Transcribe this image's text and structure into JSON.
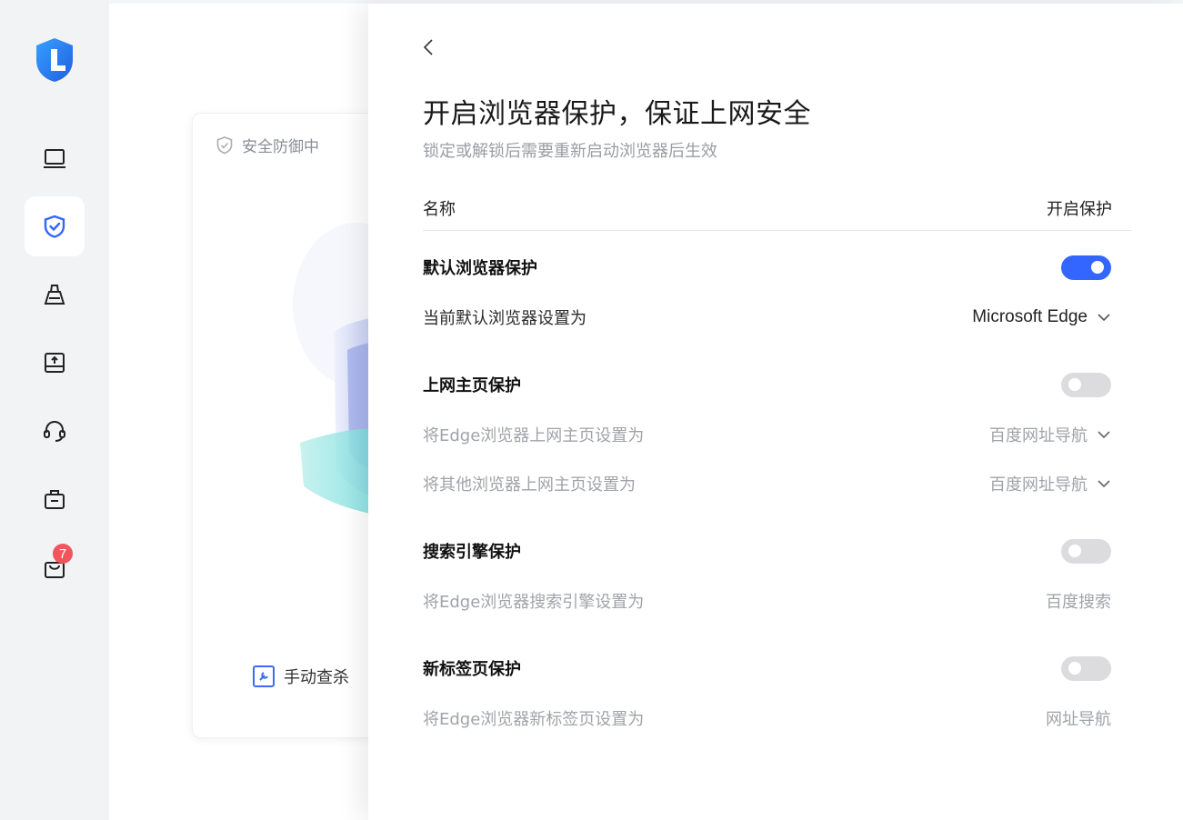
{
  "sidebar": {
    "logo_letter": "L",
    "accent": "#3366ff",
    "items": [
      {
        "name": "computer-icon"
      },
      {
        "name": "shield-check-icon",
        "active": true
      },
      {
        "name": "broom-icon"
      },
      {
        "name": "upload-drive-icon"
      },
      {
        "name": "headset-icon"
      },
      {
        "name": "toolbox-icon"
      },
      {
        "name": "shopping-bag-icon",
        "badge": "7"
      }
    ]
  },
  "background_card": {
    "status": "安全防御中",
    "action": "手动查杀"
  },
  "panel": {
    "title": "开启浏览器保护，保证上网安全",
    "subtitle": "锁定或解锁后需要重新启动浏览器后生效",
    "header": {
      "name": "名称",
      "protect": "开启保护"
    },
    "sections": [
      {
        "label": "默认浏览器保护",
        "enabled": true,
        "sub": {
          "label": "当前默认浏览器设置为",
          "value": "Microsoft Edge",
          "dropdown": true,
          "muted": false
        }
      },
      {
        "label": "上网主页保护",
        "enabled": false,
        "subs": [
          {
            "label": "将Edge浏览器上网主页设置为",
            "value": "百度网址导航",
            "dropdown": true,
            "muted": true
          },
          {
            "label": "将其他浏览器上网主页设置为",
            "value": "百度网址导航",
            "dropdown": true,
            "muted": true
          }
        ]
      },
      {
        "label": "搜索引擎保护",
        "enabled": false,
        "sub": {
          "label": "将Edge浏览器搜索引擎设置为",
          "value": "百度搜索",
          "dropdown": false,
          "muted": true
        }
      },
      {
        "label": "新标签页保护",
        "enabled": false,
        "sub": {
          "label": "将Edge浏览器新标签页设置为",
          "value": "网址导航",
          "dropdown": false,
          "muted": true
        }
      }
    ]
  }
}
